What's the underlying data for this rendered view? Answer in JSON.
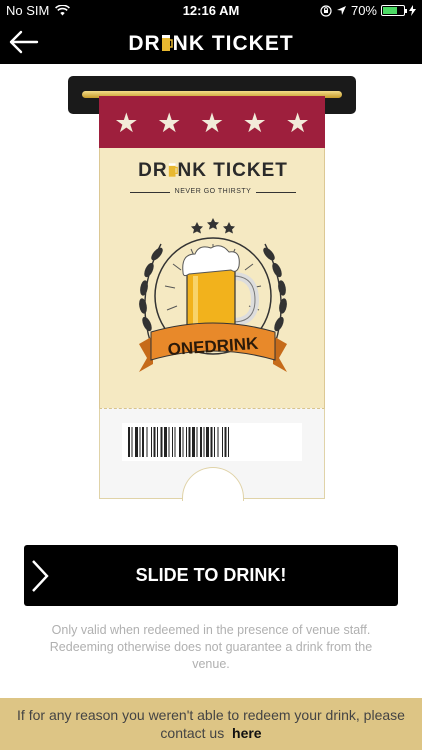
{
  "status_bar": {
    "carrier": "No SIM",
    "time": "12:16 AM",
    "battery_pct": "70%",
    "battery_level": 0.7,
    "icons": [
      "wifi-icon",
      "orientation-lock-icon",
      "location-arrow-icon",
      "charging-bolt-icon"
    ]
  },
  "nav": {
    "back_icon": "back-arrow-icon",
    "title_left": "DR",
    "title_mid": "NK",
    "title_right": "TICKET"
  },
  "ticket": {
    "stars": [
      "★",
      "★",
      "★",
      "★",
      "★"
    ],
    "logo_left": "DR",
    "logo_mid": "NK",
    "logo_right": "TICKET",
    "tagline": "NEVER GO THIRSTY",
    "banner_text": "ONEDRINK",
    "colors": {
      "header": "#9e1f3d",
      "paper": "#f5e9c2",
      "beer": "#f2b21c",
      "ribbon": "#e8892a"
    }
  },
  "slide_button": {
    "label": "SLIDE TO DRINK!",
    "icon": "chevron-right-icon"
  },
  "disclaimer": "Only valid when redeemed in the presence of venue staff. Redeeming otherwise does not guarantee a drink from the venue.",
  "footer": {
    "text": "If for any reason you weren't able to redeem your drink, please contact us",
    "link": "here",
    "color": "#ddc585"
  }
}
